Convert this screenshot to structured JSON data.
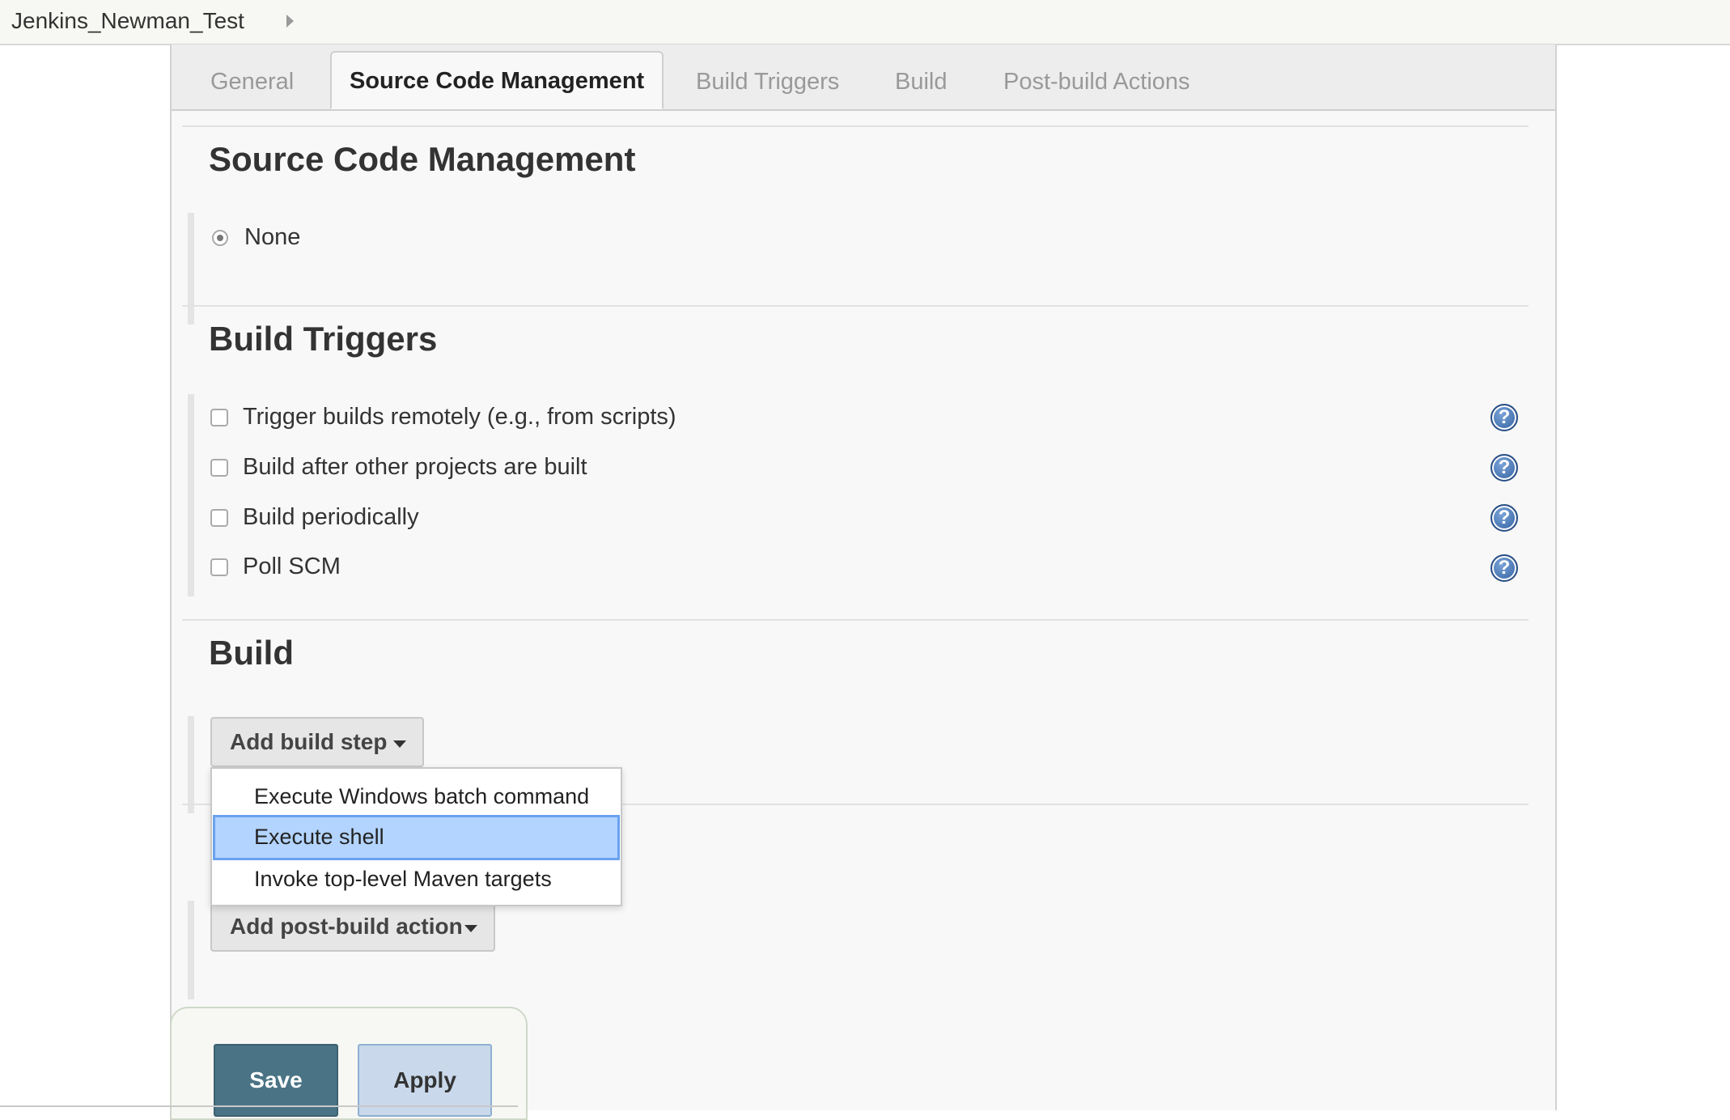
{
  "breadcrumb": {
    "project": "Jenkins_Newman_Test"
  },
  "tabs": [
    {
      "label": "General",
      "active": false
    },
    {
      "label": "Source Code Management",
      "active": true
    },
    {
      "label": "Build Triggers",
      "active": false
    },
    {
      "label": "Build",
      "active": false
    },
    {
      "label": "Post-build Actions",
      "active": false
    }
  ],
  "scm": {
    "title": "Source Code Management",
    "options": [
      {
        "label": "None",
        "selected": true
      }
    ]
  },
  "triggers": {
    "title": "Build Triggers",
    "options": [
      {
        "label": "Trigger builds remotely (e.g., from scripts)",
        "checked": false
      },
      {
        "label": "Build after other projects are built",
        "checked": false
      },
      {
        "label": "Build periodically",
        "checked": false
      },
      {
        "label": "Poll SCM",
        "checked": false
      }
    ],
    "help_glyph": "?"
  },
  "build": {
    "title": "Build",
    "add_step_label": "Add build step",
    "menu": {
      "items": [
        "Execute Windows batch command",
        "Execute shell",
        "Invoke top-level Maven targets"
      ],
      "highlighted": "Execute shell"
    }
  },
  "post_build": {
    "add_action_label": "Add post-build action"
  },
  "actions": {
    "save_label": "Save",
    "apply_label": "Apply"
  },
  "colors": {
    "save_bg": "#4a7485",
    "apply_bg": "#c9d9eb",
    "menu_highlight": "#b3d4ff",
    "help_icon": "#2f5e9e"
  },
  "icons": {
    "breadcrumb_separator": "chevron-right-icon",
    "help": "help-question-icon",
    "dropdown": "caret-down-icon"
  }
}
